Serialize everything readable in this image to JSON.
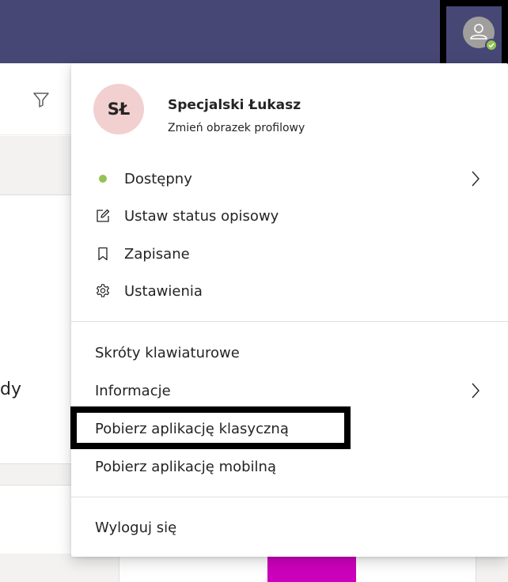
{
  "background": {
    "partial_text": "dy"
  },
  "profile": {
    "initials": "SŁ",
    "name": "Specjalski Łukasz",
    "change_picture": "Zmień obrazek profilowy"
  },
  "menu": {
    "status": "Dostępny",
    "set_status_message": "Ustaw status opisowy",
    "saved": "Zapisane",
    "settings": "Ustawienia",
    "keyboard_shortcuts": "Skróty klawiaturowe",
    "about": "Informacje",
    "download_desktop": "Pobierz aplikację klasyczną",
    "download_mobile": "Pobierz aplikację mobilną",
    "sign_out": "Wyloguj się"
  },
  "colors": {
    "topbar": "#464775",
    "presence_available": "#92c353",
    "avatar_bg": "#f2d0d0",
    "accent_magenta": "#cc00bb"
  },
  "icons": {
    "filter": "filter-icon",
    "edit_status": "edit-note-icon",
    "bookmark": "bookmark-icon",
    "settings": "gear-icon",
    "chevron": "chevron-right-icon",
    "user": "user-icon"
  }
}
